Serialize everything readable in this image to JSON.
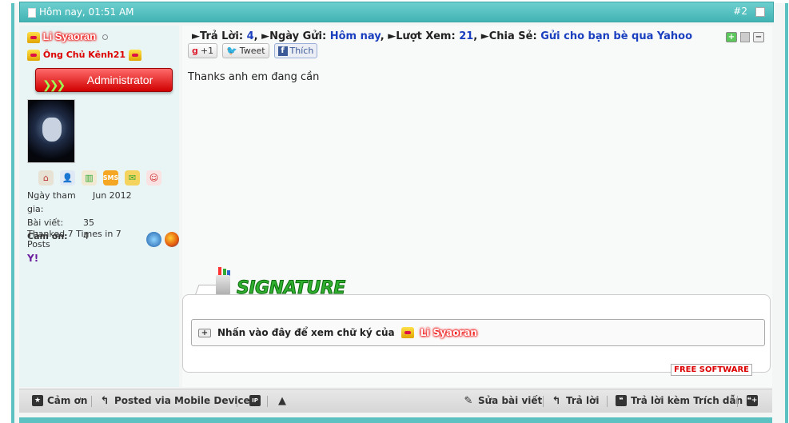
{
  "post_header": {
    "date": "Hôm nay, 01:51 AM",
    "post_number": "#2"
  },
  "user": {
    "username": "Li Syaoran",
    "title": "Ông Chủ Kênh21",
    "rank": "Administrator",
    "icons": [
      "home-icon",
      "add-friend-icon",
      "books-icon",
      "sms-icon",
      "mail-icon",
      "smiley-icon"
    ],
    "stats": {
      "join_label": "Ngày tham gia:",
      "join_value": "Jun 2012",
      "posts_label": "Bài viết:",
      "posts_value": "35",
      "thanks_label": "Cảm ơn:",
      "thanks_value": "4"
    },
    "thanked": "Thanked 7 Times in 7 Posts",
    "yahoo": "Y!"
  },
  "post_info": {
    "replies_label": "Trả Lời:",
    "replies_value": "4",
    "sent_label": "Ngày Gửi:",
    "sent_value": "Hôm nay",
    "views_label": "Lượt Xem:",
    "views_value": "21",
    "share_label": "Chia Sẻ:",
    "share_value": "Gửi cho bạn bè qua Yahoo"
  },
  "social": {
    "gplus": "+1",
    "gplus_letter": "g",
    "tweet": "Tweet",
    "like": "Thích",
    "fb_letter": "f"
  },
  "content": "Thanks anh em đang cần",
  "signature": {
    "logo_text": "SIGNATURE",
    "toggle_text": "Nhấn vào đây để xem chữ ký của",
    "toggle_user": "Li Syaoran",
    "toggle_symbol": "+",
    "badge": "FREE SOFTWARE"
  },
  "footer": {
    "thanks": "Cảm ơn",
    "mobile": "Posted via Mobile Device",
    "ip": "IP",
    "edit": "Sửa bài viết",
    "reply": "Trả lời",
    "quote": "Trả lời kèm Trích dẫn"
  },
  "colors": {
    "header": "#4fbfbf",
    "username_glow": "#e00000",
    "link": "#1a3fbf"
  }
}
